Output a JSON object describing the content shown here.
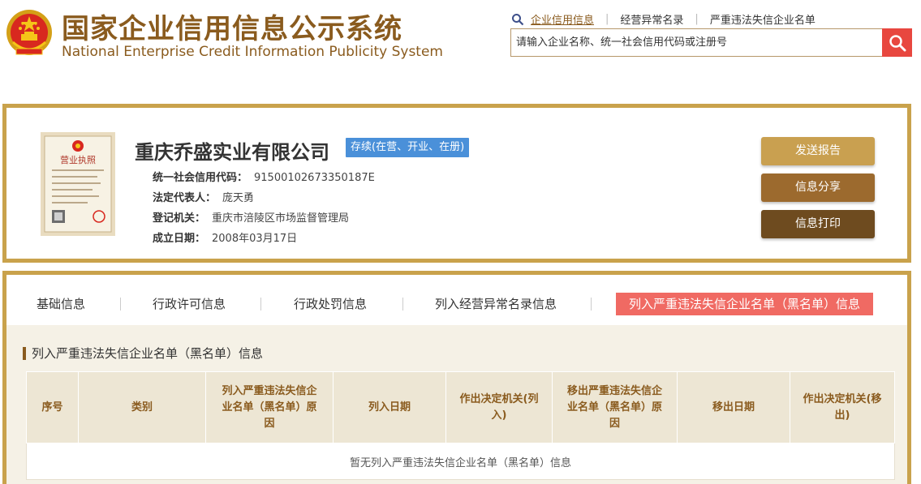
{
  "header": {
    "title_cn": "国家企业信用信息公示系统",
    "title_en": "National Enterprise Credit Information Publicity System",
    "nav": [
      {
        "label": "企业信用信息",
        "active": true
      },
      {
        "label": "经营异常名录",
        "active": false
      },
      {
        "label": "严重违法失信企业名单",
        "active": false
      }
    ],
    "search_placeholder": "请输入企业名称、统一社会信用代码或注册号"
  },
  "company": {
    "license_label": "营业执照",
    "name": "重庆乔盛实业有限公司",
    "status": "存续(在营、开业、在册)",
    "credit_code_label": "统一社会信用代码：",
    "credit_code": "91500102673350187E",
    "legal_rep_label": "法定代表人：",
    "legal_rep": "庞天勇",
    "authority_label": "登记机关：",
    "authority": "重庆市涪陵区市场监督管理局",
    "established_label": "成立日期：",
    "established": "2008年03月17日"
  },
  "actions": {
    "send_report": "发送报告",
    "share": "信息分享",
    "print": "信息打印"
  },
  "tabs": [
    {
      "label": "基础信息",
      "active": false
    },
    {
      "label": "行政许可信息",
      "active": false
    },
    {
      "label": "行政处罚信息",
      "active": false
    },
    {
      "label": "列入经营异常名录信息",
      "active": false
    },
    {
      "label": "列入严重违法失信企业名单（黑名单）信息",
      "active": true
    }
  ],
  "section": {
    "title": "列入严重违法失信企业名单（黑名单）信息",
    "columns": [
      "序号",
      "类别",
      "列入严重违法失信企业名单（黑名单）原因",
      "列入日期",
      "作出决定机关(列入)",
      "移出严重违法失信企业名单（黑名单）原因",
      "移出日期",
      "作出决定机关(移出)"
    ],
    "empty_text": "暂无列入严重违法失信企业名单（黑名单）信息"
  },
  "colors": {
    "brand_brown": "#8a5b1e",
    "gold_border": "#c9a24c",
    "status_blue": "#4a90d9",
    "active_tab": "#f06a63",
    "search_red": "#e8473f"
  }
}
